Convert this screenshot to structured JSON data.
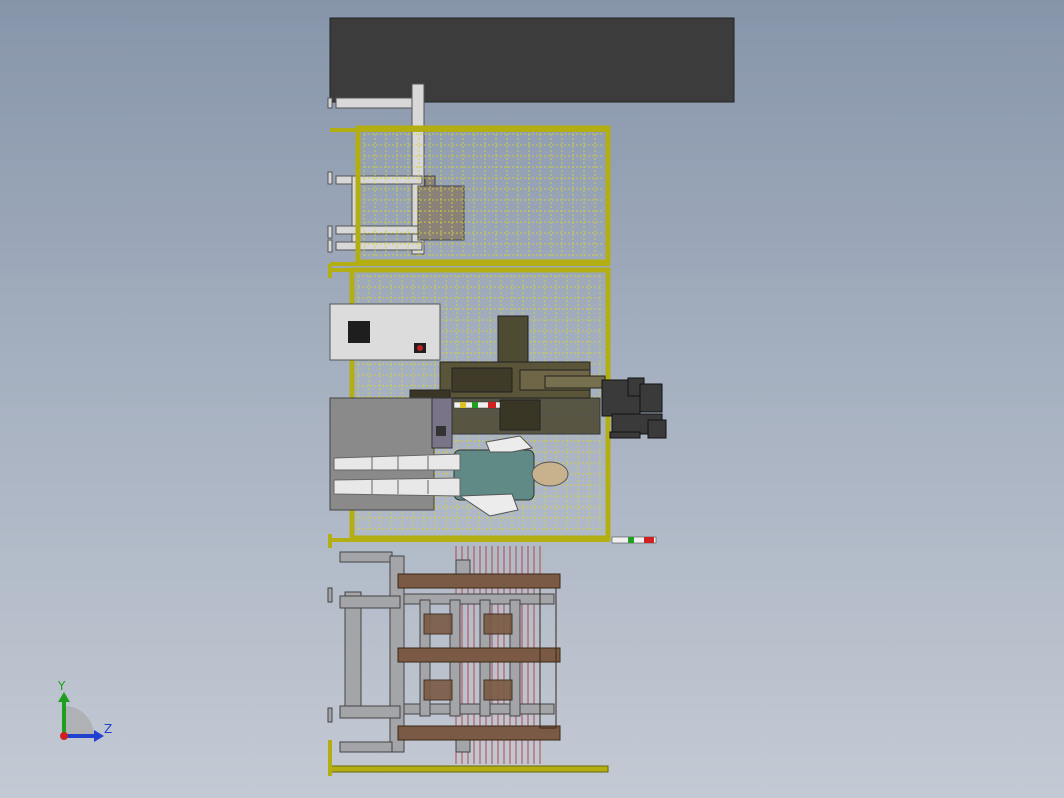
{
  "viewport": {
    "background_top": "#8795aa",
    "background_bottom": "#c4cad4"
  },
  "colors": {
    "frame_yellow": "#c8c31a",
    "mesh_yellow": "#d6d23a",
    "dark_panel": "#3c3c3c",
    "grey_steel": "#a3a5a8",
    "light_steel": "#d8d8d8",
    "wood_brown": "#7a5a44",
    "robot_olive": "#4f4a32",
    "worker_shirt": "#5f8a86",
    "worker_skin": "#c8b28e",
    "stack_light_red": "#d02020",
    "stack_light_green": "#20a020",
    "stack_light_white": "#f0f0f0",
    "strap_red": "#b34848"
  },
  "triad": {
    "y_label": "Y",
    "z_label": "Z",
    "y_color": "#1ea01e",
    "z_color": "#2040d0",
    "origin_color": "#d02020"
  },
  "components": [
    "overhead-dark-panel",
    "pallet-conveyor-top",
    "safety-fence-upper",
    "safety-fence-middle",
    "electrical-control-cabinet",
    "robot-control-box",
    "industrial-robot-arm",
    "end-effector-gripper",
    "stack-light-inner",
    "stack-light-outer",
    "human-operator",
    "pallet-dispenser",
    "wooden-pallet-stack",
    "bottom-rail"
  ]
}
